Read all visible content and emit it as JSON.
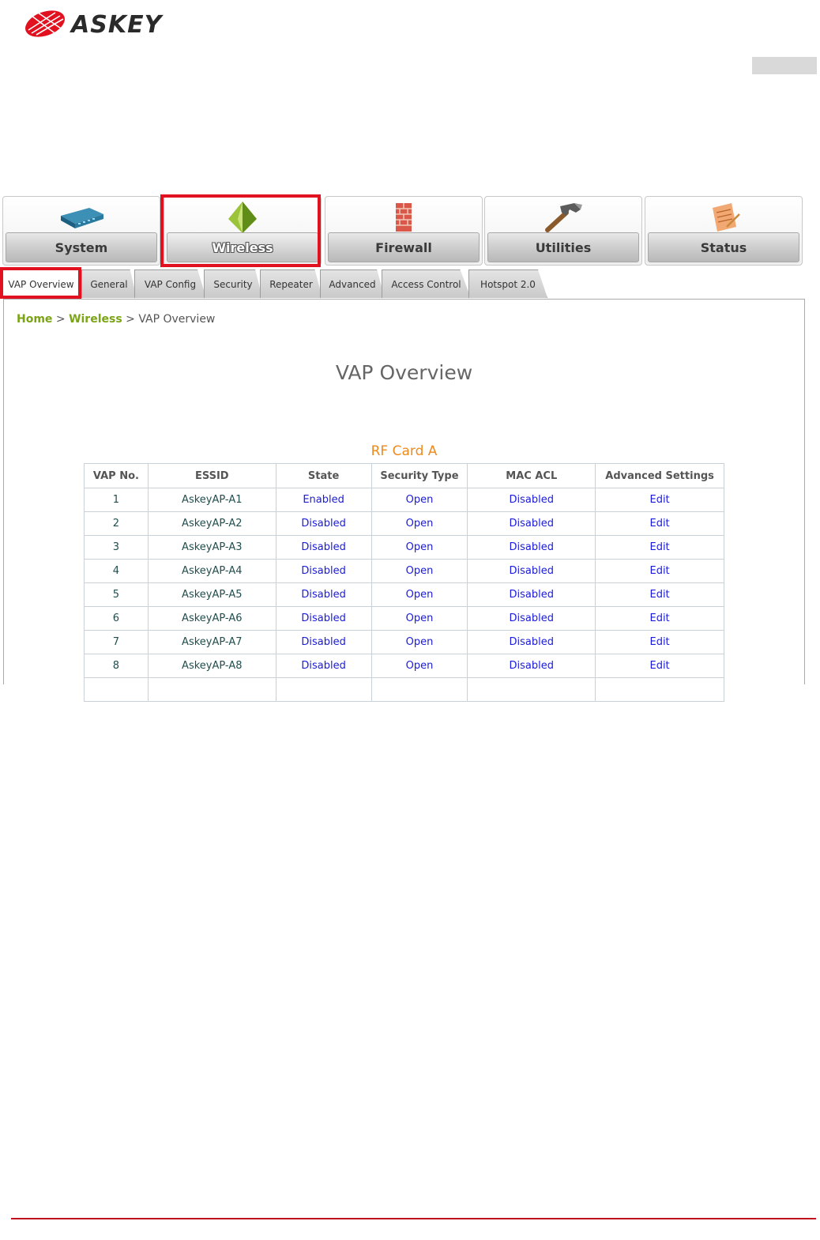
{
  "brand": {
    "name": "ASKEY",
    "accent": "#e2111f"
  },
  "main_nav": [
    {
      "label": "System",
      "icon": "network-switch-icon",
      "active": false
    },
    {
      "label": "Wireless",
      "icon": "pyramid-icon",
      "active": true
    },
    {
      "label": "Firewall",
      "icon": "brick-wall-icon",
      "active": false
    },
    {
      "label": "Utilities",
      "icon": "hammer-icon",
      "active": false
    },
    {
      "label": "Status",
      "icon": "notepad-icon",
      "active": false
    }
  ],
  "sub_tabs": [
    {
      "label": "VAP Overview",
      "active": true
    },
    {
      "label": "General"
    },
    {
      "label": "VAP Config"
    },
    {
      "label": "Security"
    },
    {
      "label": "Repeater"
    },
    {
      "label": "Advanced"
    },
    {
      "label": "Access Control"
    },
    {
      "label": "Hotspot 2.0"
    }
  ],
  "breadcrumb": {
    "home": "Home",
    "sep1": " > ",
    "section": "Wireless",
    "sep2": " > ",
    "current": "VAP Overview"
  },
  "page_title": "VAP Overview",
  "rf_card_title": "RF Card A",
  "table": {
    "headers": [
      "VAP No.",
      "ESSID",
      "State",
      "Security Type",
      "MAC ACL",
      "Advanced Settings"
    ],
    "rows": [
      [
        "1",
        "AskeyAP-A1",
        "Enabled",
        "Open",
        "Disabled",
        "Edit"
      ],
      [
        "2",
        "AskeyAP-A2",
        "Disabled",
        "Open",
        "Disabled",
        "Edit"
      ],
      [
        "3",
        "AskeyAP-A3",
        "Disabled",
        "Open",
        "Disabled",
        "Edit"
      ],
      [
        "4",
        "AskeyAP-A4",
        "Disabled",
        "Open",
        "Disabled",
        "Edit"
      ],
      [
        "5",
        "AskeyAP-A5",
        "Disabled",
        "Open",
        "Disabled",
        "Edit"
      ],
      [
        "6",
        "AskeyAP-A6",
        "Disabled",
        "Open",
        "Disabled",
        "Edit"
      ],
      [
        "7",
        "AskeyAP-A7",
        "Disabled",
        "Open",
        "Disabled",
        "Edit"
      ],
      [
        "8",
        "AskeyAP-A8",
        "Disabled",
        "Open",
        "Disabled",
        "Edit"
      ]
    ]
  }
}
